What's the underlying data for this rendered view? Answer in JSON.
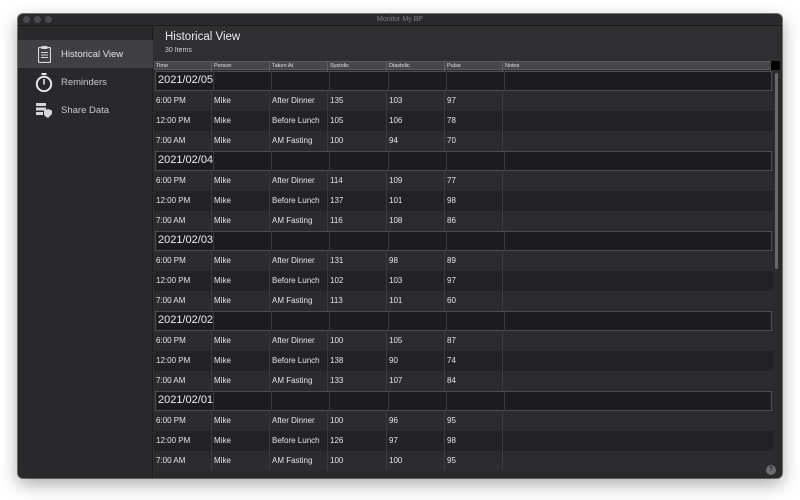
{
  "window": {
    "title": "Monitor My BP"
  },
  "sidebar": {
    "items": [
      {
        "label": "Historical View",
        "icon": "clipboard-icon",
        "selected": true
      },
      {
        "label": "Reminders",
        "icon": "stopwatch-icon",
        "selected": false
      },
      {
        "label": "Share Data",
        "icon": "share-data-icon",
        "selected": false
      }
    ]
  },
  "main": {
    "title": "Historical View",
    "item_count": "30 Items"
  },
  "table": {
    "columns": [
      "Time",
      "Person",
      "Taken At",
      "Systolic",
      "Diastolic",
      "Pulse",
      "Notes"
    ],
    "groups": [
      {
        "date": "2021/02/05",
        "rows": [
          {
            "time": "6:00 PM",
            "person": "Mike",
            "taken_at": "After Dinner",
            "systolic": "135",
            "diastolic": "103",
            "pulse": "97",
            "notes": ""
          },
          {
            "time": "12:00 PM",
            "person": "Mike",
            "taken_at": "Before Lunch",
            "systolic": "105",
            "diastolic": "106",
            "pulse": "78",
            "notes": ""
          },
          {
            "time": "7:00 AM",
            "person": "Mike",
            "taken_at": "AM Fasting",
            "systolic": "100",
            "diastolic": "94",
            "pulse": "70",
            "notes": ""
          }
        ]
      },
      {
        "date": "2021/02/04",
        "rows": [
          {
            "time": "6:00 PM",
            "person": "Mike",
            "taken_at": "After Dinner",
            "systolic": "114",
            "diastolic": "109",
            "pulse": "77",
            "notes": ""
          },
          {
            "time": "12:00 PM",
            "person": "Mike",
            "taken_at": "Before Lunch",
            "systolic": "137",
            "diastolic": "101",
            "pulse": "98",
            "notes": ""
          },
          {
            "time": "7:00 AM",
            "person": "Mike",
            "taken_at": "AM Fasting",
            "systolic": "116",
            "diastolic": "108",
            "pulse": "86",
            "notes": ""
          }
        ]
      },
      {
        "date": "2021/02/03",
        "rows": [
          {
            "time": "6:00 PM",
            "person": "Mike",
            "taken_at": "After Dinner",
            "systolic": "131",
            "diastolic": "98",
            "pulse": "89",
            "notes": ""
          },
          {
            "time": "12:00 PM",
            "person": "Mike",
            "taken_at": "Before Lunch",
            "systolic": "102",
            "diastolic": "103",
            "pulse": "97",
            "notes": ""
          },
          {
            "time": "7:00 AM",
            "person": "Mike",
            "taken_at": "AM Fasting",
            "systolic": "113",
            "diastolic": "101",
            "pulse": "60",
            "notes": ""
          }
        ]
      },
      {
        "date": "2021/02/02",
        "rows": [
          {
            "time": "6:00 PM",
            "person": "Mike",
            "taken_at": "After Dinner",
            "systolic": "100",
            "diastolic": "105",
            "pulse": "87",
            "notes": ""
          },
          {
            "time": "12:00 PM",
            "person": "Mike",
            "taken_at": "Before Lunch",
            "systolic": "138",
            "diastolic": "90",
            "pulse": "74",
            "notes": ""
          },
          {
            "time": "7:00 AM",
            "person": "Mike",
            "taken_at": "AM Fasting",
            "systolic": "133",
            "diastolic": "107",
            "pulse": "84",
            "notes": ""
          }
        ]
      },
      {
        "date": "2021/02/01",
        "rows": [
          {
            "time": "6:00 PM",
            "person": "Mike",
            "taken_at": "After Dinner",
            "systolic": "100",
            "diastolic": "96",
            "pulse": "95",
            "notes": ""
          },
          {
            "time": "12:00 PM",
            "person": "Mike",
            "taken_at": "Before Lunch",
            "systolic": "126",
            "diastolic": "97",
            "pulse": "98",
            "notes": ""
          },
          {
            "time": "7:00 AM",
            "person": "Mike",
            "taken_at": "AM Fasting",
            "systolic": "100",
            "diastolic": "100",
            "pulse": "95",
            "notes": ""
          }
        ]
      }
    ]
  },
  "toolbar": {
    "buttons": [
      {
        "name": "add-button",
        "icon": "plus-icon",
        "glyph": "+"
      },
      {
        "name": "remove-button",
        "icon": "minus-icon",
        "glyph": "−"
      },
      {
        "name": "navigate-button",
        "icon": "circle-arrow-icon",
        "glyph": ""
      },
      {
        "name": "share-button",
        "icon": "share-icon",
        "glyph": ""
      },
      {
        "name": "list-button",
        "icon": "list-icon",
        "glyph": ""
      },
      {
        "name": "filter-button",
        "icon": "search-circle-icon",
        "glyph": ""
      }
    ],
    "help_label": "?"
  }
}
